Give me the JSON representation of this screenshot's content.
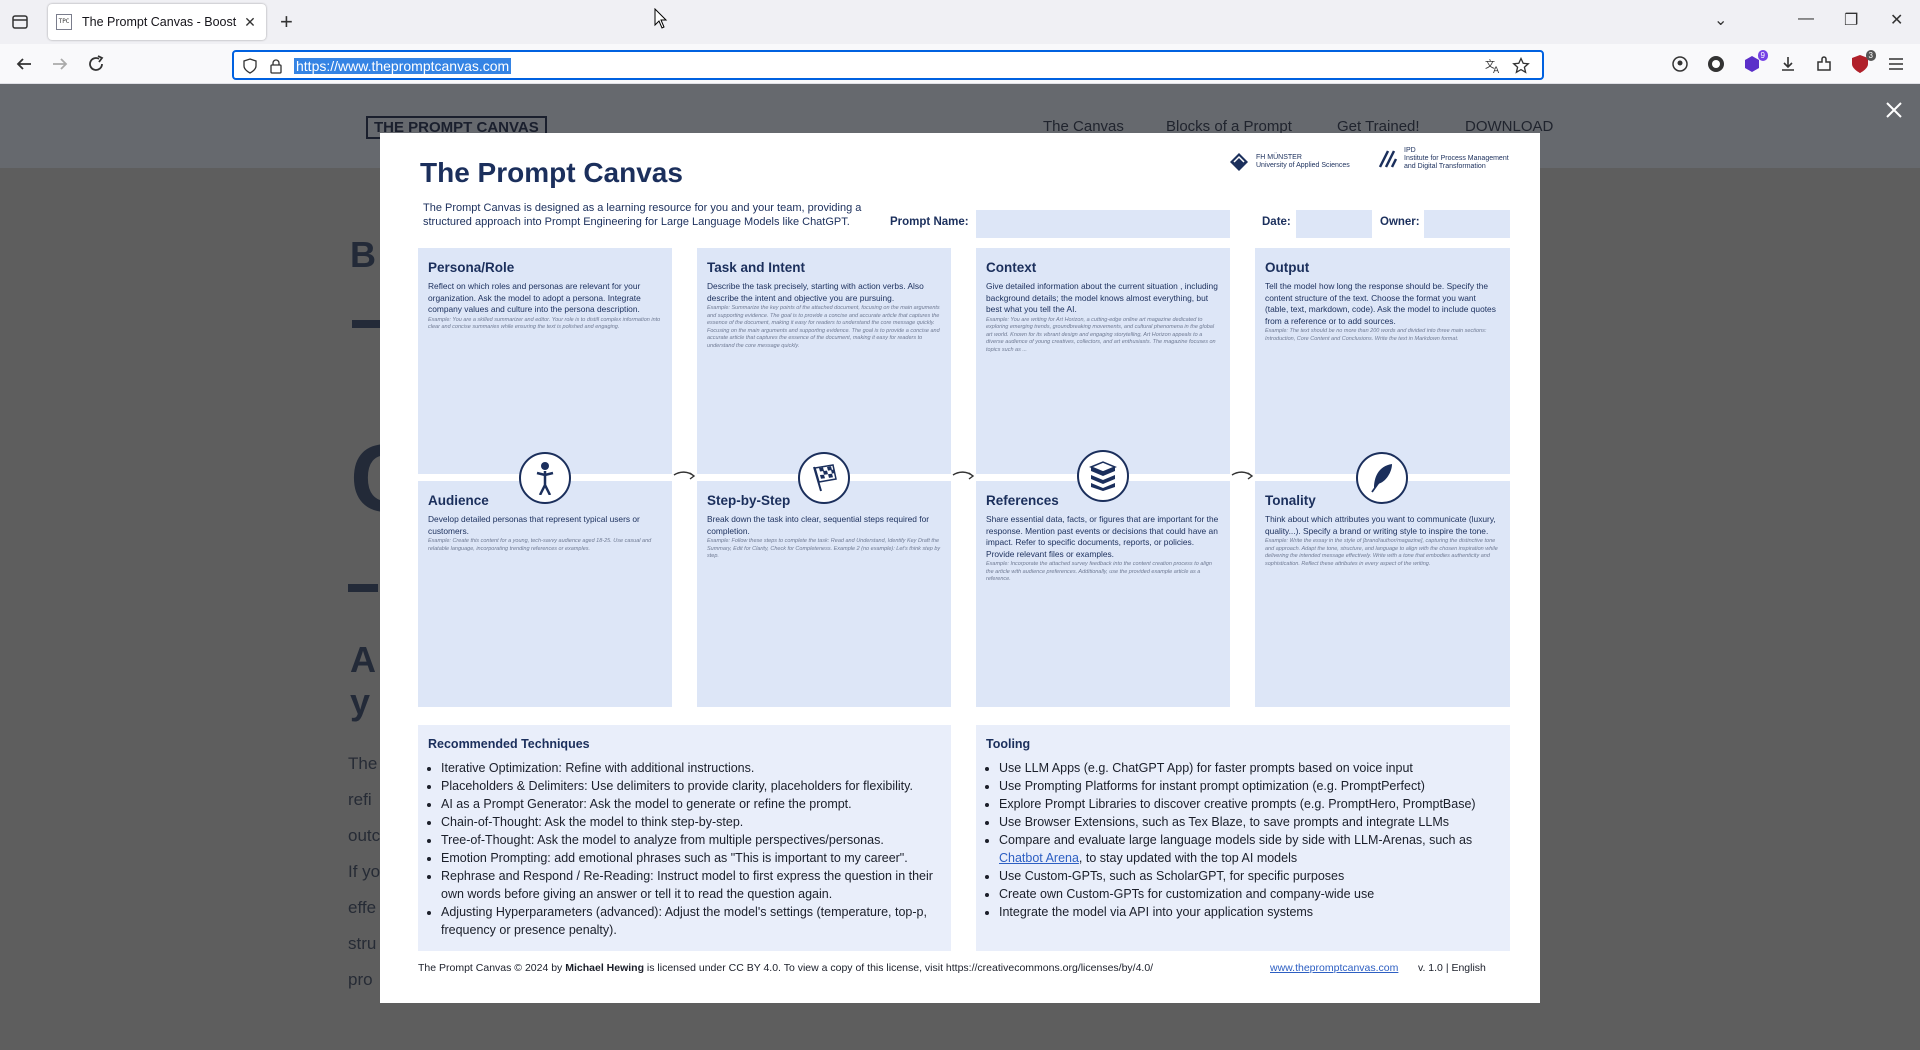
{
  "browser": {
    "tab_title": "The Prompt Canvas - Boost you",
    "favicon_text": "TPC",
    "url": "https://www.thepromptcanvas.com",
    "extension_badges": [
      "9",
      "3"
    ]
  },
  "site": {
    "logo": "THE PROMPT CANVAS",
    "nav": [
      "The Canvas",
      "Blocks of a Prompt",
      "Get Trained!",
      "DOWNLOAD"
    ],
    "bg_fragments": {
      "b": "B",
      "c": "C",
      "a1": "A",
      "a2": "y",
      "lines": [
        "The",
        "refi",
        "outc",
        "If yo",
        "effe",
        "stru",
        "pro"
      ]
    }
  },
  "canvas": {
    "title": "The Prompt Canvas",
    "intro": "The Prompt Canvas is designed as a learning resource for you and your team, providing a structured approach into Prompt Engineering for Large Language Models like ChatGPT.",
    "logo1_lines": [
      "FH MÜNSTER",
      "University of Applied Sciences"
    ],
    "logo2_lines": [
      "IPD",
      "Institute for Process Management",
      "and Digital Transformation"
    ],
    "prompt_name_label": "Prompt Name:",
    "date_label": "Date:",
    "owner_label": "Owner:",
    "cards": {
      "persona": {
        "title": "Persona/Role",
        "desc": "Reflect on which roles and personas are relevant for your organization. Ask the model to adopt a persona. Integrate company values and culture into the persona description.",
        "example": "Example: You are a skilled summarizer and editor. Your role is to distill complex information into clear and concise summaries while ensuring the text is polished and engaging."
      },
      "task": {
        "title": "Task and Intent",
        "desc": "Describe the task precisely, starting with action verbs. Also describe the intent and objective you are pursuing.",
        "example": "Example: Summarize the key points of the attached document, focusing on the main arguments and supporting evidence. The goal is to provide a concise and accurate article that captures the essence of the document, making it easy for readers to understand the core message quickly. Focusing on the main arguments and supporting evidence. The goal is to provide a concise and accurate article that captures the essence of the document, making it easy for readers to understand the core message quickly."
      },
      "context": {
        "title": "Context",
        "desc": "Give detailed information about the current situation , including background details; the model knows almost everything, but best what you tell the AI.",
        "example": "Example: You are writing for Art Horizon, a cutting-edge online art magazine dedicated to exploring emerging trends, groundbreaking movements, and cultural phenomena in the global art world. Known for its vibrant design and engaging storytelling, Art Horizon appeals to a diverse audience of young creatives, collectors, and art enthusiasts. The magazine focuses on topics such as ..."
      },
      "output": {
        "title": "Output",
        "desc": "Tell the model how long the response should be. Specify the content structure of the text. Choose the format you want (table, text, markdown, code). Ask the model to include quotes from a reference or to add sources.",
        "example": "Example: The text should be no more than 200 words and divided into three main sections: Introduction, Core Content and Conclusions. Write the text in Markdown format."
      },
      "audience": {
        "title": "Audience",
        "desc": "Develop detailed personas that represent typical users or customers.",
        "example": "Example: Create this content for a young, tech-savvy audience aged 18-25. Use casual and relatable language, incorporating trending references or examples."
      },
      "step": {
        "title": "Step-by-Step",
        "desc": "Break down the task into clear, sequential steps required for completion.",
        "example": "Example: Follow these steps to complete the task: Read and Understand, Identify Key Draft the Summary, Edit for Clarity, Check for Completeness. Example 2 (no example): Let's think step by step."
      },
      "references": {
        "title": "References",
        "desc": "Share essential data, facts, or figures that are important for the response. Mention past events or decisions that could have an impact. Refer to specific documents, reports, or policies. Provide relevant files or examples.",
        "example": "Example: Incorporate the attached survey feedback into the content creation process to align the article with audience preferences. Additionally, use the provided example article as a reference."
      },
      "tonality": {
        "title": "Tonality",
        "desc": "Think about which attributes you want to communicate (luxury, quality...). Specify a brand or writing style to inspire the tone.",
        "example": "Example: Write the essay in the style of [brand/author/magazine], capturing the distinctive tone and approach. Adapt the tone, structure, and language to align with the chosen inspiration while delivering the intended message effectively. Write with a tone that embodies authenticity and sophistication. Reflect these attributes in every aspect of the writing."
      }
    },
    "techniques": {
      "title": "Recommended Techniques",
      "items": [
        "Iterative Optimization: Refine with additional instructions.",
        "Placeholders & Delimiters: Use delimiters to provide clarity, placeholders for flexibility.",
        "AI as a Prompt Generator: Ask the model to generate or refine the prompt.",
        "Chain-of-Thought: Ask the model to think step-by-step.",
        "Tree-of-Thought: Ask the model to analyze from multiple perspectives/personas.",
        "Emotion Prompting: add emotional phrases such as \"This is important to my career\".",
        "Rephrase and Respond / Re-Reading: Instruct model to first express the question in their own words before giving an answer or tell it to read the question again.",
        "Adjusting Hyperparameters (advanced): Adjust the model's settings (temperature, top-p, frequency or presence penalty)."
      ]
    },
    "tooling": {
      "title": "Tooling",
      "items": [
        "Use LLM Apps (e.g. ChatGPT App) for faster prompts based on voice input",
        "Use Prompting Platforms for instant prompt optimization (e.g. PromptPerfect)",
        "Explore Prompt Libraries to discover creative prompts (e.g. PromptHero, PromptBase)",
        "Use Browser Extensions, such as Tex Blaze, to save prompts and integrate LLMs"
      ],
      "arena_pre": "Compare and evaluate large language models side by side with LLM-Arenas, such as ",
      "arena_link": "Chatbot Arena",
      "arena_post": ", to stay updated with the top AI models",
      "items2": [
        "Use Custom-GPTs, such as ScholarGPT, for specific purposes",
        "Create own Custom-GPTs for customization and company-wide use",
        "Integrate the model via API into your application systems"
      ]
    },
    "footer": {
      "pre": "The Prompt Canvas © 2024 by ",
      "author": "Michael Hewing",
      "post": " is licensed under CC BY 4.0. To view a copy of this license, visit https://creativecommons.org/licenses/by/4.0/",
      "link": "www.thepromptcanvas.com",
      "version": "v. 1.0 | English"
    }
  },
  "colors": {
    "navy": "#1b2f5c",
    "card": "#dde6f7",
    "accent": "#0061e0",
    "overlay": "#5e5e5e"
  }
}
